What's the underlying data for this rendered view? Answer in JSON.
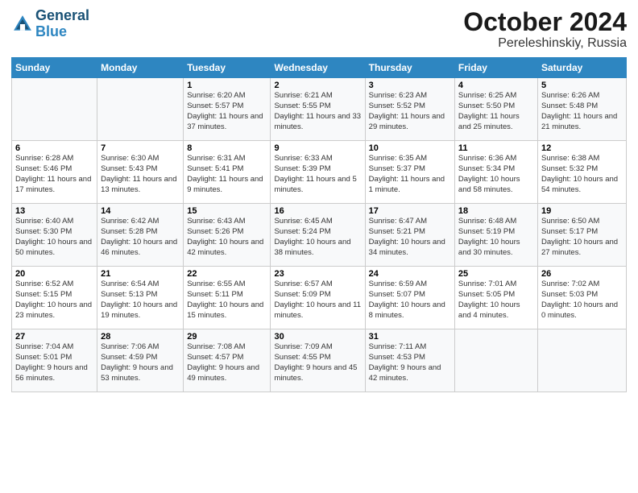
{
  "header": {
    "logo_line1": "General",
    "logo_line2": "Blue",
    "title": "October 2024",
    "subtitle": "Pereleshinskiy, Russia"
  },
  "weekdays": [
    "Sunday",
    "Monday",
    "Tuesday",
    "Wednesday",
    "Thursday",
    "Friday",
    "Saturday"
  ],
  "weeks": [
    [
      {
        "day": "",
        "sunrise": "",
        "sunset": "",
        "daylight": ""
      },
      {
        "day": "",
        "sunrise": "",
        "sunset": "",
        "daylight": ""
      },
      {
        "day": "1",
        "sunrise": "Sunrise: 6:20 AM",
        "sunset": "Sunset: 5:57 PM",
        "daylight": "Daylight: 11 hours and 37 minutes."
      },
      {
        "day": "2",
        "sunrise": "Sunrise: 6:21 AM",
        "sunset": "Sunset: 5:55 PM",
        "daylight": "Daylight: 11 hours and 33 minutes."
      },
      {
        "day": "3",
        "sunrise": "Sunrise: 6:23 AM",
        "sunset": "Sunset: 5:52 PM",
        "daylight": "Daylight: 11 hours and 29 minutes."
      },
      {
        "day": "4",
        "sunrise": "Sunrise: 6:25 AM",
        "sunset": "Sunset: 5:50 PM",
        "daylight": "Daylight: 11 hours and 25 minutes."
      },
      {
        "day": "5",
        "sunrise": "Sunrise: 6:26 AM",
        "sunset": "Sunset: 5:48 PM",
        "daylight": "Daylight: 11 hours and 21 minutes."
      }
    ],
    [
      {
        "day": "6",
        "sunrise": "Sunrise: 6:28 AM",
        "sunset": "Sunset: 5:46 PM",
        "daylight": "Daylight: 11 hours and 17 minutes."
      },
      {
        "day": "7",
        "sunrise": "Sunrise: 6:30 AM",
        "sunset": "Sunset: 5:43 PM",
        "daylight": "Daylight: 11 hours and 13 minutes."
      },
      {
        "day": "8",
        "sunrise": "Sunrise: 6:31 AM",
        "sunset": "Sunset: 5:41 PM",
        "daylight": "Daylight: 11 hours and 9 minutes."
      },
      {
        "day": "9",
        "sunrise": "Sunrise: 6:33 AM",
        "sunset": "Sunset: 5:39 PM",
        "daylight": "Daylight: 11 hours and 5 minutes."
      },
      {
        "day": "10",
        "sunrise": "Sunrise: 6:35 AM",
        "sunset": "Sunset: 5:37 PM",
        "daylight": "Daylight: 11 hours and 1 minute."
      },
      {
        "day": "11",
        "sunrise": "Sunrise: 6:36 AM",
        "sunset": "Sunset: 5:34 PM",
        "daylight": "Daylight: 10 hours and 58 minutes."
      },
      {
        "day": "12",
        "sunrise": "Sunrise: 6:38 AM",
        "sunset": "Sunset: 5:32 PM",
        "daylight": "Daylight: 10 hours and 54 minutes."
      }
    ],
    [
      {
        "day": "13",
        "sunrise": "Sunrise: 6:40 AM",
        "sunset": "Sunset: 5:30 PM",
        "daylight": "Daylight: 10 hours and 50 minutes."
      },
      {
        "day": "14",
        "sunrise": "Sunrise: 6:42 AM",
        "sunset": "Sunset: 5:28 PM",
        "daylight": "Daylight: 10 hours and 46 minutes."
      },
      {
        "day": "15",
        "sunrise": "Sunrise: 6:43 AM",
        "sunset": "Sunset: 5:26 PM",
        "daylight": "Daylight: 10 hours and 42 minutes."
      },
      {
        "day": "16",
        "sunrise": "Sunrise: 6:45 AM",
        "sunset": "Sunset: 5:24 PM",
        "daylight": "Daylight: 10 hours and 38 minutes."
      },
      {
        "day": "17",
        "sunrise": "Sunrise: 6:47 AM",
        "sunset": "Sunset: 5:21 PM",
        "daylight": "Daylight: 10 hours and 34 minutes."
      },
      {
        "day": "18",
        "sunrise": "Sunrise: 6:48 AM",
        "sunset": "Sunset: 5:19 PM",
        "daylight": "Daylight: 10 hours and 30 minutes."
      },
      {
        "day": "19",
        "sunrise": "Sunrise: 6:50 AM",
        "sunset": "Sunset: 5:17 PM",
        "daylight": "Daylight: 10 hours and 27 minutes."
      }
    ],
    [
      {
        "day": "20",
        "sunrise": "Sunrise: 6:52 AM",
        "sunset": "Sunset: 5:15 PM",
        "daylight": "Daylight: 10 hours and 23 minutes."
      },
      {
        "day": "21",
        "sunrise": "Sunrise: 6:54 AM",
        "sunset": "Sunset: 5:13 PM",
        "daylight": "Daylight: 10 hours and 19 minutes."
      },
      {
        "day": "22",
        "sunrise": "Sunrise: 6:55 AM",
        "sunset": "Sunset: 5:11 PM",
        "daylight": "Daylight: 10 hours and 15 minutes."
      },
      {
        "day": "23",
        "sunrise": "Sunrise: 6:57 AM",
        "sunset": "Sunset: 5:09 PM",
        "daylight": "Daylight: 10 hours and 11 minutes."
      },
      {
        "day": "24",
        "sunrise": "Sunrise: 6:59 AM",
        "sunset": "Sunset: 5:07 PM",
        "daylight": "Daylight: 10 hours and 8 minutes."
      },
      {
        "day": "25",
        "sunrise": "Sunrise: 7:01 AM",
        "sunset": "Sunset: 5:05 PM",
        "daylight": "Daylight: 10 hours and 4 minutes."
      },
      {
        "day": "26",
        "sunrise": "Sunrise: 7:02 AM",
        "sunset": "Sunset: 5:03 PM",
        "daylight": "Daylight: 10 hours and 0 minutes."
      }
    ],
    [
      {
        "day": "27",
        "sunrise": "Sunrise: 7:04 AM",
        "sunset": "Sunset: 5:01 PM",
        "daylight": "Daylight: 9 hours and 56 minutes."
      },
      {
        "day": "28",
        "sunrise": "Sunrise: 7:06 AM",
        "sunset": "Sunset: 4:59 PM",
        "daylight": "Daylight: 9 hours and 53 minutes."
      },
      {
        "day": "29",
        "sunrise": "Sunrise: 7:08 AM",
        "sunset": "Sunset: 4:57 PM",
        "daylight": "Daylight: 9 hours and 49 minutes."
      },
      {
        "day": "30",
        "sunrise": "Sunrise: 7:09 AM",
        "sunset": "Sunset: 4:55 PM",
        "daylight": "Daylight: 9 hours and 45 minutes."
      },
      {
        "day": "31",
        "sunrise": "Sunrise: 7:11 AM",
        "sunset": "Sunset: 4:53 PM",
        "daylight": "Daylight: 9 hours and 42 minutes."
      },
      {
        "day": "",
        "sunrise": "",
        "sunset": "",
        "daylight": ""
      },
      {
        "day": "",
        "sunrise": "",
        "sunset": "",
        "daylight": ""
      }
    ]
  ]
}
